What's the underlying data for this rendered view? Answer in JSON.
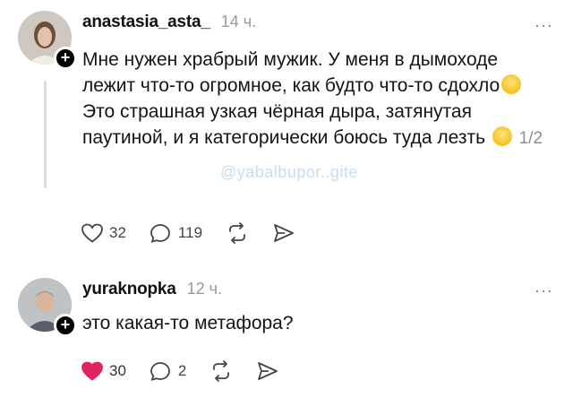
{
  "posts": [
    {
      "username": "anastasia_asta_",
      "timestamp": "14 ч.",
      "text_before_emoji1": "Мне нужен храбрый мужик. У меня в дымоходе лежит что-то огромное, как будто что-то сдохло",
      "text_after_emoji1": " Это страшная узкая чёрная дыра, затянутая паутиной, и я категорически боюсь туда лезть ",
      "pager": "1/2",
      "watermark": "@yabalbupor..gite",
      "likes": "32",
      "comments": "119",
      "liked": false
    },
    {
      "username": "yuraknopka",
      "timestamp": "12 ч.",
      "text": "это какая-то метафора?",
      "likes": "30",
      "comments": "2",
      "liked": true
    }
  ],
  "more_label": "···",
  "follow_label": "+",
  "icons": {
    "like": "heart-icon",
    "comment": "comment-bubble-icon",
    "repost": "repost-icon",
    "share": "send-icon"
  },
  "colors": {
    "like_active": "#e0245e",
    "muted": "#9a9a9a"
  }
}
